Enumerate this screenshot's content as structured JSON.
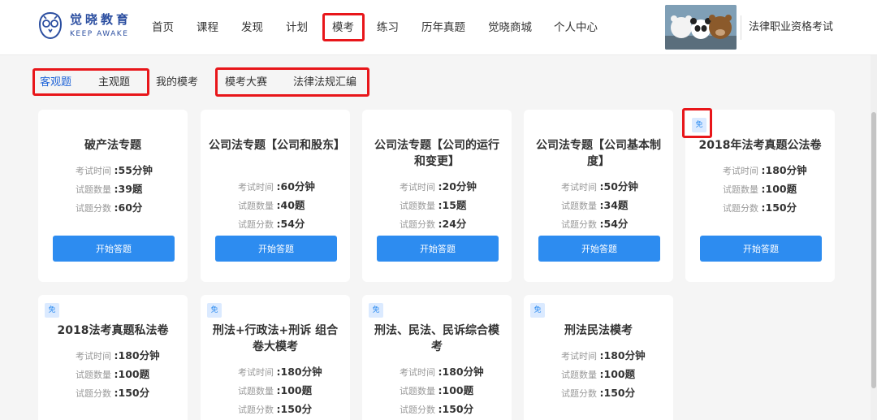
{
  "brand": {
    "name_cn": "觉晓教育",
    "name_en": "KEEP AWAKE"
  },
  "nav": [
    "首页",
    "课程",
    "发现",
    "计划",
    "模考",
    "练习",
    "历年真题",
    "觉晓商城",
    "个人中心"
  ],
  "exam_name": "法律职业资格考试",
  "tabs": [
    "客观题",
    "主观题",
    "我的模考",
    "模考大赛",
    "法律法规汇编"
  ],
  "labels": {
    "time": "考试时间",
    "count": "试题数量",
    "score": "试题分数",
    "start": "开始答题",
    "free": "免"
  },
  "cards": [
    {
      "title": "破产法专题",
      "time": ":55分钟",
      "count": ":39题",
      "score": ":60分"
    },
    {
      "title": "公司法专题【公司和股东】",
      "time": ":60分钟",
      "count": ":40题",
      "score": ":54分"
    },
    {
      "title": "公司法专题【公司的运行和变更】",
      "time": ":20分钟",
      "count": ":15题",
      "score": ":24分"
    },
    {
      "title": "公司法专题【公司基本制度】",
      "time": ":50分钟",
      "count": ":34题",
      "score": ":54分"
    },
    {
      "title": "2018年法考真题公法卷",
      "time": ":180分钟",
      "count": ":100题",
      "score": ":150分"
    },
    {
      "title": "2018法考真题私法卷",
      "time": ":180分钟",
      "count": ":100题",
      "score": ":150分"
    },
    {
      "title": "刑法+行政法+刑诉 组合卷大模考",
      "time": ":180分钟",
      "count": ":100题",
      "score": ":150分"
    },
    {
      "title": "刑法、民法、民诉综合模考",
      "time": ":180分钟",
      "count": ":100题",
      "score": ":150分"
    },
    {
      "title": "刑法民法模考",
      "time": ":180分钟",
      "count": ":100题",
      "score": ":150分"
    }
  ],
  "colors": {
    "accent": "#2d8cf0",
    "highlight": "#e8161a",
    "brand": "#2b4ea0"
  }
}
